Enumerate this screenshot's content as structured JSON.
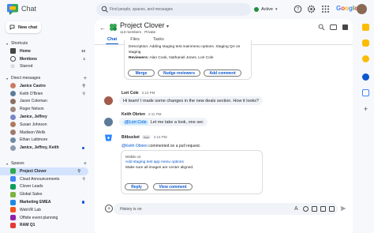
{
  "app": {
    "title": "Chat"
  },
  "search": {
    "placeholder": "Find people, spaces, and messages"
  },
  "status": {
    "label": "Active"
  },
  "brand": "Google",
  "sidebar": {
    "new_chat_label": "New chat",
    "shortcuts_header": "Shortcuts",
    "shortcuts": [
      {
        "label": "Home",
        "count": "10",
        "icon": "home-icon"
      },
      {
        "label": "Mentions",
        "count": "1",
        "icon": "at-icon"
      },
      {
        "label": "Starred",
        "count": "",
        "icon": "star-icon"
      }
    ],
    "dm_header": "Direct messages",
    "dms": [
      {
        "label": "Janice Castro",
        "bold": true,
        "marker": "bell",
        "color": "#c97b63"
      },
      {
        "label": "Keith O'Brien",
        "bold": false,
        "marker": "pin",
        "color": "#5c7c99"
      },
      {
        "label": "Jason Coleman",
        "bold": false,
        "marker": "",
        "color": "#8d6e63"
      },
      {
        "label": "Roger Nelson",
        "bold": false,
        "marker": "",
        "color": "#a1887f"
      },
      {
        "label": "Janice, Jeffrey",
        "bold": true,
        "marker": "",
        "color": "#7986cb"
      },
      {
        "label": "Susan Johnson",
        "bold": false,
        "marker": "",
        "color": "#b07a5a"
      },
      {
        "label": "Madison Wells",
        "bold": false,
        "marker": "",
        "color": "#9e7b6b"
      },
      {
        "label": "Ethan Lattimore",
        "bold": false,
        "marker": "",
        "color": "#6d8ca3"
      },
      {
        "label": "Janice, Jeffrey, Keith",
        "bold": true,
        "marker": "dot",
        "color": "#8e9aaf"
      }
    ],
    "spaces_header": "Spaces",
    "spaces": [
      {
        "label": "Project Clover",
        "active": true,
        "bold": true,
        "marker": "pin",
        "color": "#34a853"
      },
      {
        "label": "Cloud Announcements",
        "active": false,
        "bold": false,
        "marker": "pin",
        "color": "#4285f4"
      },
      {
        "label": "Clover Leads",
        "active": false,
        "bold": false,
        "marker": "",
        "color": "#0f9d58"
      },
      {
        "label": "Global Sales",
        "active": false,
        "bold": false,
        "marker": "",
        "color": "#7cb342"
      },
      {
        "label": "Marketing EMEA",
        "active": false,
        "bold": true,
        "marker": "dot",
        "color": "#1e88e5"
      },
      {
        "label": "WebVR Lab",
        "active": false,
        "bold": false,
        "marker": "",
        "color": "#f4511e"
      },
      {
        "label": "Offsite event planning",
        "active": false,
        "bold": false,
        "marker": "",
        "color": "#8e24aa"
      },
      {
        "label": "RAM Q1",
        "active": false,
        "bold": true,
        "marker": "",
        "color": "#e53935"
      }
    ]
  },
  "space": {
    "title": "Project Clover",
    "subtitle": "113 members · Private",
    "tabs": [
      "Chat",
      "Files",
      "Tasks"
    ]
  },
  "messages": {
    "top_card": {
      "line1": "Description: Adding staging test mainmenu options. Staging QA on",
      "line2": "staging",
      "reviewers_label": "Reviewers:",
      "reviewers": "Alan Cook, Nathaniel Jones, Lori Cole",
      "buttons": [
        "Merge",
        "Nudge reviewers",
        "Add comment"
      ]
    },
    "lori": {
      "name": "Lori Cole",
      "time": "2:10 PM",
      "text": "Hi team! I made some changes in the new deals section. How it looks?"
    },
    "keith": {
      "name": "Keith Obrien",
      "time": "2:11 PM",
      "mention": "@Lori Cole",
      "text": "Let me take a look, one sec"
    },
    "bot": {
      "name": "Bitbucket",
      "app_badge": "App",
      "time": "2:14 PM",
      "mention": "@Keith Obrien",
      "text": "commented on a pull request.",
      "card_repo": "MObile v2",
      "card_title": "Add staging test app menu options",
      "card_body": "Make sure all images are center aligned.",
      "buttons": [
        "Reply",
        "View comment"
      ]
    }
  },
  "composer": {
    "placeholder": "History is on"
  }
}
